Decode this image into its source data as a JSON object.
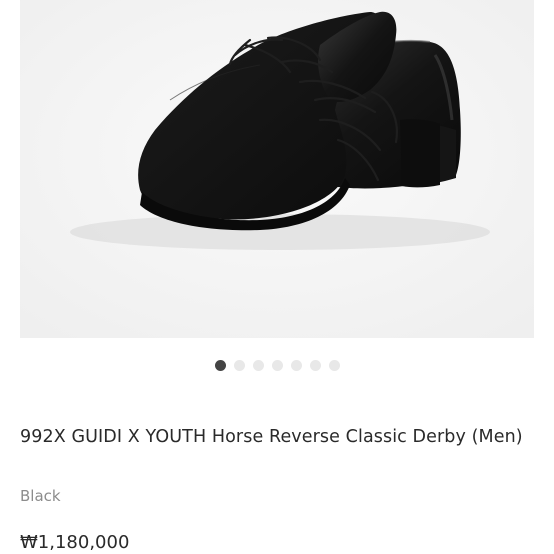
{
  "product": {
    "image_icon": "black-leather-derby-shoes",
    "gallery": {
      "image_count": 7,
      "active_index": 0
    },
    "title": "992X GUIDI X YOUTH Horse Reverse Classic Derby (Men)",
    "color": "Black",
    "price": "₩1,180,000"
  }
}
